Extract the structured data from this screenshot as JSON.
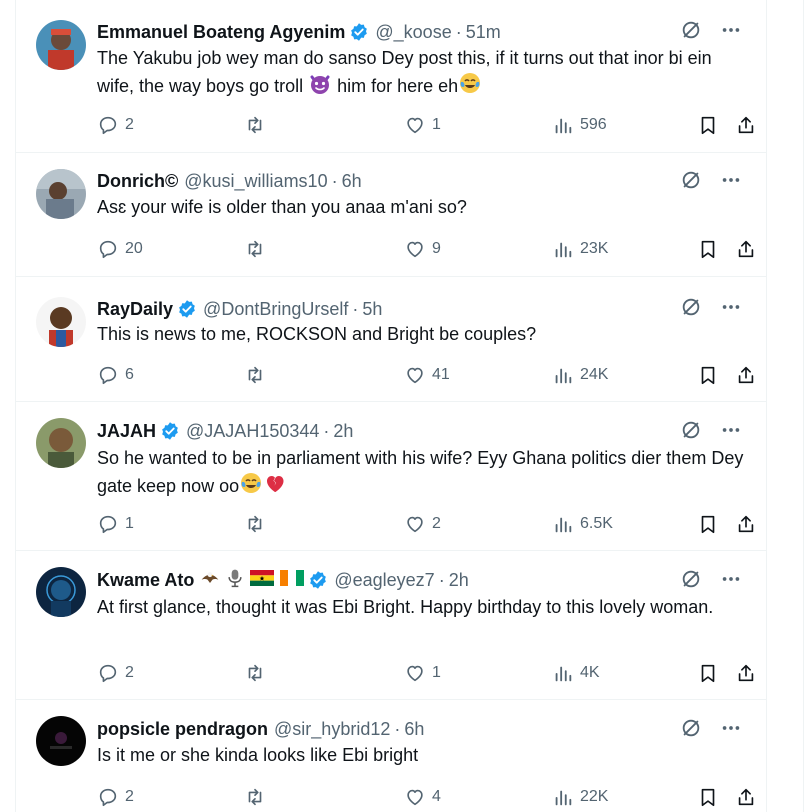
{
  "tweets": [
    {
      "name": "Emmanuel Boateng Agyenim",
      "handle": "@_koose",
      "time": "51m",
      "verified": true,
      "text_parts": [
        "The Yakubu job wey man do sanso Dey post this, if it turns out that inor bi ein wife, the way boys go troll ",
        " him for here eh"
      ],
      "emojis": [
        "smiling-face-with-horns",
        "face-with-tears-of-joy"
      ],
      "replies": "2",
      "retweets": "",
      "likes": "1",
      "views": "596",
      "avatar_color": "#c0392b"
    },
    {
      "name": "Donrich©",
      "handle": "@kusi_williams10",
      "time": "6h",
      "verified": false,
      "text": "Asɛ your wife is older than you anaa m'ani so?",
      "replies": "20",
      "retweets": "",
      "likes": "9",
      "views": "23K",
      "avatar_color": "#6b7b8c"
    },
    {
      "name": "RayDaily",
      "handle": "@DontBringUrself",
      "time": "5h",
      "verified": true,
      "text": "This is news to me, ROCKSON and Bright be couples?",
      "replies": "6",
      "retweets": "",
      "likes": "41",
      "views": "24K",
      "avatar_color": "#f2f2f2"
    },
    {
      "name": "JAJAH",
      "handle": "@JAJAH150344",
      "time": "2h",
      "verified": true,
      "text_parts": [
        "So he wanted to be in parliament with his wife? Eyy Ghana politics dier them Dey gate keep now oo"
      ],
      "emojis": [
        "face-with-tears-of-joy",
        "broken-heart"
      ],
      "replies": "1",
      "retweets": "",
      "likes": "2",
      "views": "6.5K",
      "avatar_color": "#7a5a3a"
    },
    {
      "name": "Kwame Ato",
      "handle": "@eagleyez7",
      "time": "2h",
      "verified": true,
      "name_emojis": [
        "eagle",
        "microphone",
        "ghana-flag",
        "ivory-coast-flag"
      ],
      "text": "At first glance, thought it was Ebi Bright. Happy birthday to this lovely woman.",
      "replies": "2",
      "retweets": "",
      "likes": "1",
      "views": "4K",
      "avatar_color": "#0d2540"
    },
    {
      "name": "popsicle pendragon",
      "handle": "@sir_hybrid12",
      "time": "6h",
      "verified": false,
      "text": "Is it me or she kinda looks like Ebi bright",
      "replies": "2",
      "retweets": "",
      "likes": "4",
      "views": "22K",
      "avatar_color": "#050505"
    }
  ],
  "icons": {
    "reply": "reply-icon",
    "retweet": "retweet-icon",
    "like": "like-icon",
    "views": "views-icon",
    "bookmark": "bookmark-icon",
    "share": "share-icon",
    "grok": "grok-icon",
    "more": "more-icon"
  },
  "colors": {
    "verified": "#1d9bf0",
    "muted": "#536471",
    "text": "#0f1419",
    "divider": "#eff3f4"
  }
}
